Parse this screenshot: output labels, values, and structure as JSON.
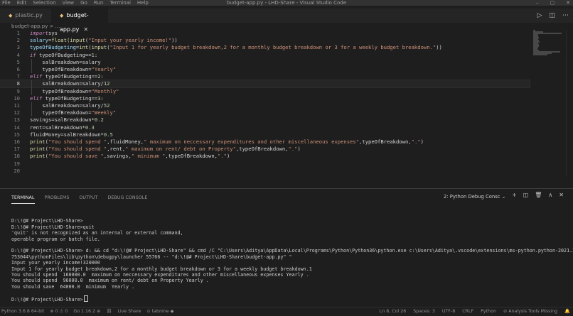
{
  "menu": [
    "File",
    "Edit",
    "Selection",
    "View",
    "Go",
    "Run",
    "Terminal",
    "Help"
  ],
  "window_title": "budget-app.py - LHD-Share - Visual Studio Code",
  "window_controls": [
    "–",
    "▢",
    "✕"
  ],
  "tabs": [
    {
      "label": "plastic.py",
      "icon": "python-file-icon"
    },
    {
      "label": "budget-app.py",
      "icon": "python-file-icon",
      "close": "✕"
    }
  ],
  "editor_actions": [
    "▷",
    "◫",
    "⋯"
  ],
  "breadcrumb": "budget-app.py > ...",
  "line_numbers": [
    "1",
    "2",
    "3",
    "4",
    "5",
    "6",
    "7",
    "8",
    "9",
    "10",
    "11",
    "12",
    "13",
    "14",
    "15",
    "16",
    "17",
    "18",
    "19",
    "20"
  ],
  "code_lines": [
    [
      [
        "kw",
        "import"
      ],
      [
        "",
        "sys"
      ]
    ],
    [
      [
        "vr",
        "salary"
      ],
      [
        "",
        "="
      ],
      [
        "fn",
        "float"
      ],
      [
        "",
        "("
      ],
      [
        "fn",
        "input"
      ],
      [
        "",
        "("
      ],
      [
        "st",
        "\"Input your yearly income!\""
      ],
      [
        "",
        "))"
      ]
    ],
    [
      [
        "vr",
        "typeOfBudgeting"
      ],
      [
        "",
        "="
      ],
      [
        "fn",
        "int"
      ],
      [
        "",
        "("
      ],
      [
        "fn",
        "input"
      ],
      [
        "",
        "("
      ],
      [
        "st",
        "\"Input 1 for yearly budget breakdown,2 for a monthly budget breakdown or 3 for a weekly budget breakdown.\""
      ],
      [
        "",
        "))"
      ]
    ],
    [
      [
        "kw",
        "if"
      ],
      [
        "",
        " typeOfBudgeting=="
      ],
      [
        "nm",
        "1"
      ],
      [
        "",
        ":"
      ]
    ],
    [
      [
        "",
        "    salBreakdown=salary"
      ]
    ],
    [
      [
        "",
        "    typeOfBreakdown="
      ],
      [
        "st",
        "\"Yearly\""
      ]
    ],
    [
      [
        "kw",
        "elif"
      ],
      [
        "",
        " typeOfBudgeting=="
      ],
      [
        "nm",
        "2"
      ],
      [
        "",
        ":"
      ]
    ],
    [
      [
        "",
        "    salBreakdown=salary/"
      ],
      [
        "nm",
        "12"
      ]
    ],
    [
      [
        "",
        "    typeOfBreakdown="
      ],
      [
        "st",
        "\"Monthly\""
      ]
    ],
    [
      [
        "kw",
        "elif"
      ],
      [
        "",
        " typeOfBudgeting=="
      ],
      [
        "nm",
        "3"
      ],
      [
        "",
        ":"
      ]
    ],
    [
      [
        "",
        "    salBreakdown=salary/"
      ],
      [
        "nm",
        "52"
      ]
    ],
    [
      [
        "",
        "    typeOfBreakdown="
      ],
      [
        "st",
        "\"Weekly\""
      ]
    ],
    [
      [
        "",
        "savings=salBreakdown*"
      ],
      [
        "nm",
        "0.2"
      ]
    ],
    [
      [
        "",
        "rent=salBreakdown*"
      ],
      [
        "nm",
        "0.3"
      ]
    ],
    [
      [
        "",
        "fluidMoney=salBreakdown*"
      ],
      [
        "nm",
        "0.5"
      ]
    ],
    [
      [
        "fn",
        "print"
      ],
      [
        "",
        "("
      ],
      [
        "st",
        "\"You should spend \""
      ],
      [
        "",
        ",fluidMoney,"
      ],
      [
        "st",
        "\" maximum on neccessary expenditures and other miscellaneous expenses\""
      ],
      [
        "",
        ",typeOfBreakdown,"
      ],
      [
        "st",
        "\".\""
      ],
      [
        "",
        ")"
      ]
    ],
    [
      [
        "fn",
        "print"
      ],
      [
        "",
        "("
      ],
      [
        "st",
        "\"You should spend \""
      ],
      [
        "",
        ",rent,"
      ],
      [
        "st",
        "\" maximum on rent/ debt on Property\""
      ],
      [
        "",
        ",typeOfBreakdown,"
      ],
      [
        "st",
        "\".\""
      ],
      [
        "",
        ")"
      ]
    ],
    [
      [
        "fn",
        "print"
      ],
      [
        "",
        "("
      ],
      [
        "st",
        "\"You should save \""
      ],
      [
        "",
        ",savings,"
      ],
      [
        "st",
        "\" minimum \""
      ],
      [
        "",
        ",typeOfBreakdown,"
      ],
      [
        "st",
        "\".\""
      ],
      [
        "",
        ")"
      ]
    ],
    [
      [
        "",
        ""
      ]
    ],
    [
      [
        "",
        ""
      ]
    ]
  ],
  "current_line": 8,
  "panel_tabs": [
    "TERMINAL",
    "PROBLEMS",
    "OUTPUT",
    "DEBUG CONSOLE"
  ],
  "terminal_select": "2: Python Debug Consc ⌄",
  "panel_actions": [
    "+",
    "◫",
    "🗑",
    "∧",
    "✕"
  ],
  "terminal_lines": [
    "",
    "D:\\!@# Project\\LHD-Share>",
    "D:\\!@# Project\\LHD-Share>quit",
    "'quit' is not recognized as an internal or external command,",
    "operable program or batch file.",
    "",
    "D:\\!@# Project\\LHD-Share> d: && cd \"d:\\!@# Project\\LHD-Share\" && cmd /C \"C:\\Users\\Aditya\\AppData\\Local\\Programs\\Python\\Python36\\python.exe c:\\Users\\Aditya\\.vscode\\extensions\\ms-python.python-2021.3.680",
    "753044\\pythonFiles\\lib\\python\\debugpy\\launcher 55766 -- \"d:\\!@# Project\\LHD-Share\\budget-app.py\" \"",
    "Input your yearly income!320000",
    "Input 1 for yearly budget breakdown,2 for a monthly budget breakdown or 3 for a weekly budget breakdown.1",
    "You should spend  160000.0  maximum on neccessary expenditures and other miscellaneous expenses Yearly .",
    "You should spend  96000.0  maximum on rent/ debt on Property Yearly .",
    "You should save  64000.0  minimum  Yearly .",
    "",
    "D:\\!@# Project\\LHD-Share>"
  ],
  "status_left": [
    "Python 3.6.8 64-bit",
    "⊗ 0 ⚠ 0",
    "Go 1.16.2 ⊕",
    "⛓",
    "Live Share",
    "⊙ tabnine ◆"
  ],
  "status_right": [
    "Ln 8, Col 26",
    "Spaces: 3",
    "UTF-8",
    "CRLF",
    "Python",
    "⊘ Analysis Tools Missing",
    "🔔"
  ]
}
